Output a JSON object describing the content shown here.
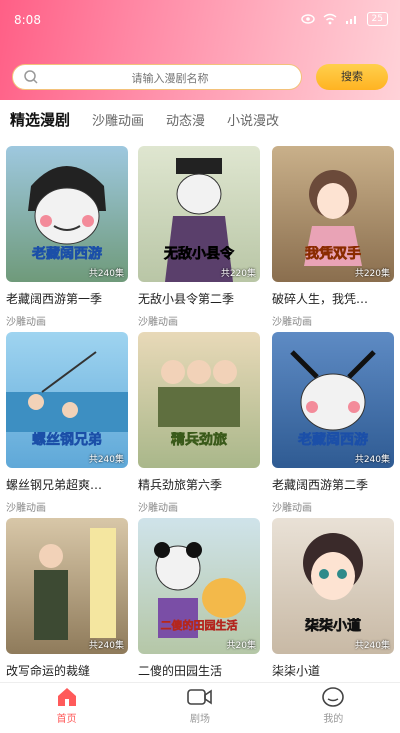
{
  "status_bar": {
    "time": "8:08",
    "battery": "25"
  },
  "search": {
    "placeholder": "请输入漫剧名称",
    "button": "搜索"
  },
  "tabs": [
    {
      "label": "精选漫剧",
      "active": true
    },
    {
      "label": "沙雕动画",
      "active": false
    },
    {
      "label": "动态漫",
      "active": false
    },
    {
      "label": "小说漫改",
      "active": false
    }
  ],
  "cards": [
    {
      "title": "老藏阔西游第一季",
      "category": "沙雕动画",
      "cover_title": "老藏阔西游",
      "cover_badge": "共240集"
    },
    {
      "title": "无敌小县令第二季",
      "category": "沙雕动画",
      "cover_title": "无敌小县令",
      "cover_badge": "共220集"
    },
    {
      "title": "破碎人生，我凭…",
      "category": "沙雕动画",
      "cover_title": "我凭双手",
      "cover_badge": "共220集"
    },
    {
      "title": "螺丝钢兄弟超爽…",
      "category": "沙雕动画",
      "cover_title": "螺丝钢兄弟",
      "cover_badge": "共240集"
    },
    {
      "title": "精兵劲旅第六季",
      "category": "沙雕动画",
      "cover_title": "精兵劲旅",
      "cover_badge": ""
    },
    {
      "title": "老藏阔西游第二季",
      "category": "沙雕动画",
      "cover_title": "老藏阔西游",
      "cover_badge": "共240集"
    },
    {
      "title": "改写命运的裁缝",
      "category": "",
      "cover_title": "",
      "cover_badge": "共240集"
    },
    {
      "title": "二傻的田园生活",
      "category": "",
      "cover_title": "二傻的田园生活",
      "cover_badge": "共20集"
    },
    {
      "title": "柒柒小道",
      "category": "",
      "cover_title": "柒柒小道",
      "cover_badge": "共240集"
    }
  ],
  "nav": [
    {
      "label": "首页",
      "icon": "home-icon",
      "active": true
    },
    {
      "label": "剧场",
      "icon": "video-icon",
      "active": false
    },
    {
      "label": "我的",
      "icon": "profile-icon",
      "active": false
    }
  ],
  "colors": {
    "accent": "#ff5a5a",
    "search_button": "#ffc133",
    "header_gradient_start": "#ff5f86"
  }
}
